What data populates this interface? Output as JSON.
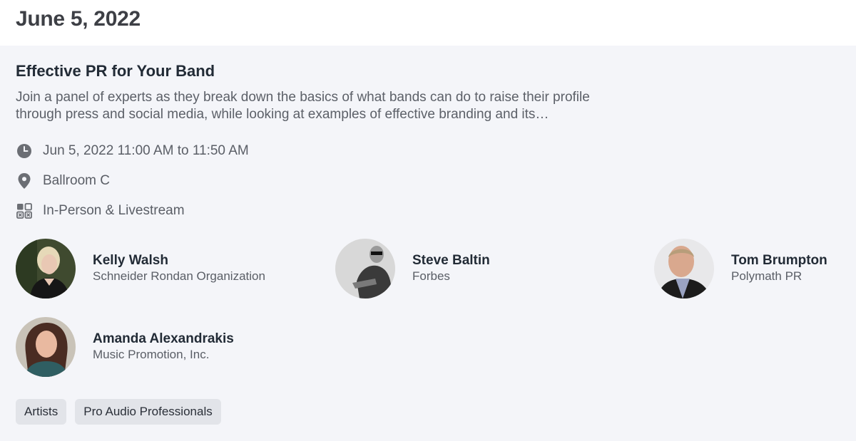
{
  "date_header": "June 5, 2022",
  "session": {
    "title": "Effective PR for Your Band",
    "description_line1": "Join a panel of experts as they break down the basics of what bands can do to raise their profile",
    "description_line2": "through press and social media, while looking at examples of effective branding and its…",
    "time": "Jun 5, 2022 11:00 AM to 11:50 AM",
    "location": "Ballroom C",
    "format": "In-Person & Livestream",
    "icons": {
      "time": "clock-icon",
      "location": "map-pin-icon",
      "format": "grid-format-icon"
    }
  },
  "speakers": [
    {
      "name": "Kelly Walsh",
      "org": "Schneider Rondan Organization"
    },
    {
      "name": "Steve Baltin",
      "org": "Forbes"
    },
    {
      "name": "Tom Brumpton",
      "org": "Polymath PR"
    },
    {
      "name": "Amanda Alexandrakis",
      "org": "Music Promotion, Inc."
    }
  ],
  "tags": [
    "Artists",
    "Pro Audio Professionals"
  ],
  "colors": {
    "page_bg": "#f4f5f9",
    "header_bg": "#ffffff",
    "tag_bg": "#e2e4e9",
    "text_dark": "#222b36",
    "text_muted": "#5a5e66",
    "icon": "#6b6e74"
  }
}
